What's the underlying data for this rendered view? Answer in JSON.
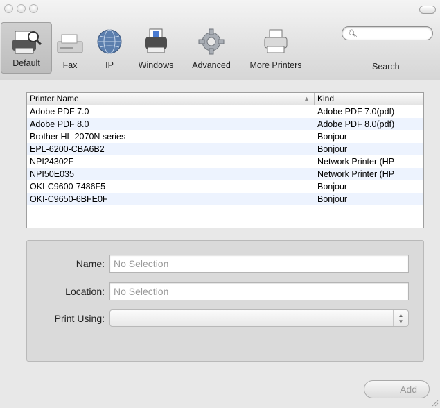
{
  "toolbar": {
    "items": [
      {
        "label": "Default",
        "icon": "default-printer-icon"
      },
      {
        "label": "Fax",
        "icon": "fax-icon"
      },
      {
        "label": "IP",
        "icon": "globe-icon"
      },
      {
        "label": "Windows",
        "icon": "windows-printer-icon"
      },
      {
        "label": "Advanced",
        "icon": "gear-icon"
      },
      {
        "label": "More Printers",
        "icon": "printer-icon"
      }
    ],
    "search_label": "Search",
    "search_value": ""
  },
  "table": {
    "col_name": "Printer Name",
    "col_kind": "Kind",
    "rows": [
      {
        "name": "Adobe PDF 7.0",
        "kind": "Adobe PDF 7.0(pdf)"
      },
      {
        "name": "Adobe PDF 8.0",
        "kind": "Adobe PDF 8.0(pdf)"
      },
      {
        "name": "Brother HL-2070N series",
        "kind": "Bonjour"
      },
      {
        "name": "EPL-6200-CBA6B2",
        "kind": "Bonjour"
      },
      {
        "name": "NPI24302F",
        "kind": "Network Printer (HP"
      },
      {
        "name": "NPI50E035",
        "kind": "Network Printer (HP"
      },
      {
        "name": "OKI-C9600-7486F5",
        "kind": "Bonjour"
      },
      {
        "name": "OKI-C9650-6BFE0F",
        "kind": "Bonjour"
      }
    ]
  },
  "form": {
    "name_label": "Name:",
    "name_value": "No Selection",
    "location_label": "Location:",
    "location_value": "No Selection",
    "print_using_label": "Print Using:",
    "print_using_value": ""
  },
  "add_button": "Add"
}
